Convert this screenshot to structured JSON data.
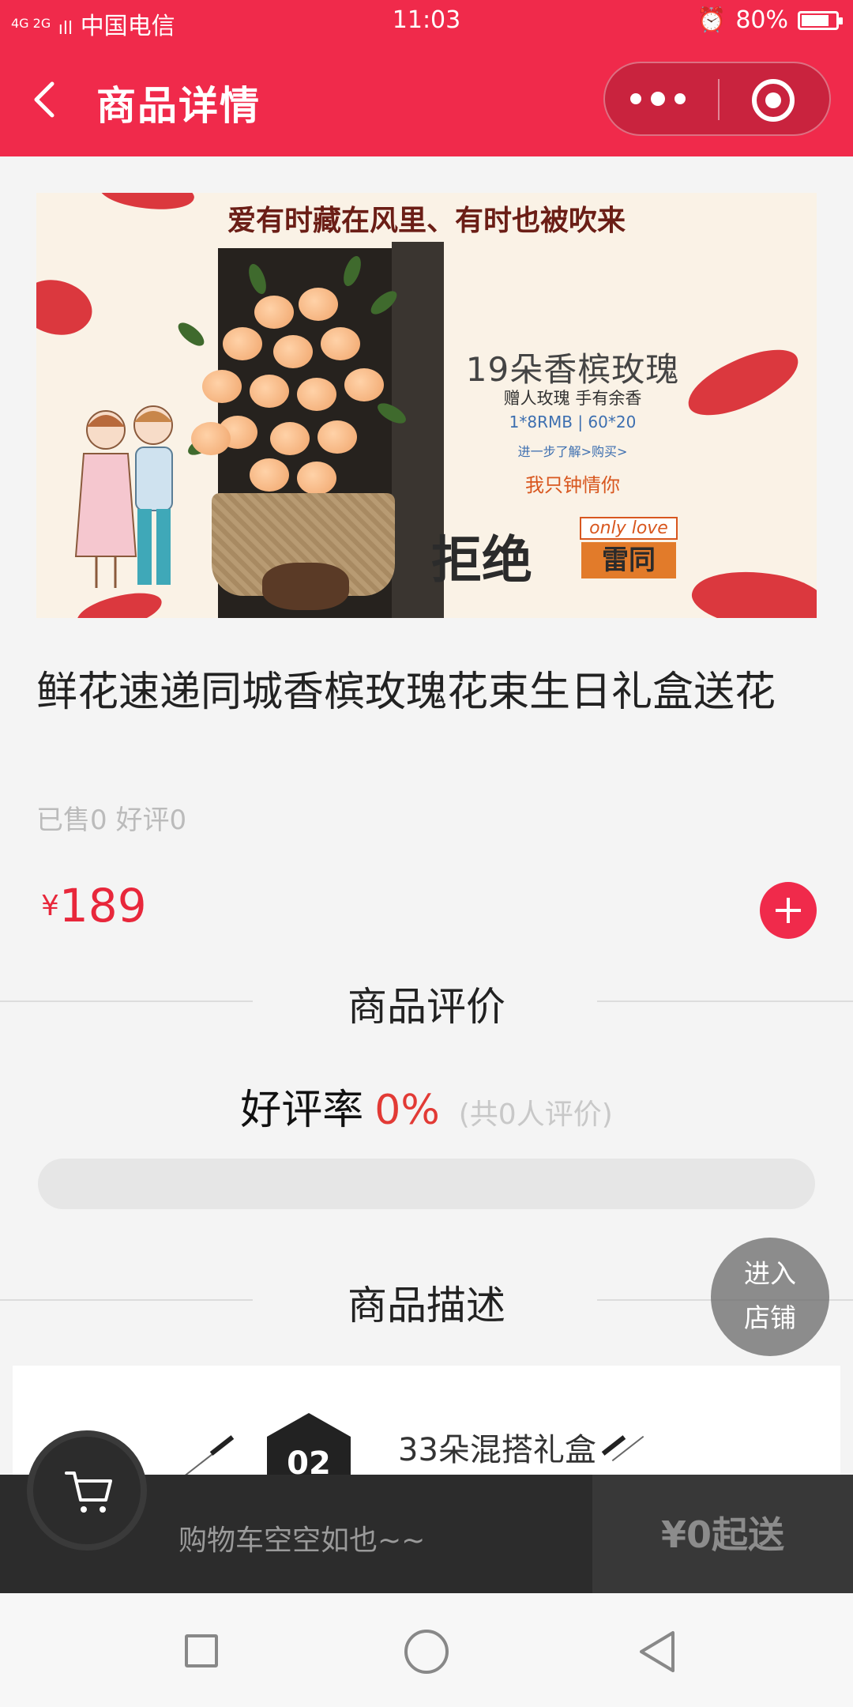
{
  "status_bar": {
    "carrier": "中国电信",
    "signal": "4G 2G",
    "time": "11:03",
    "battery": "80%",
    "battery_level": 0.8
  },
  "header": {
    "title": "商品详情",
    "back_icon": "chevron-left-icon",
    "more_icon": "more-dots-icon",
    "close_icon": "target-close-icon",
    "accent_color": "#f02a4b"
  },
  "banner": {
    "tagline": "爱有时藏在风里、有时也被吹来",
    "headline": "19朵香槟玫瑰",
    "subline": "赠人玫瑰 手有余香",
    "spec": "1*8RMB | 60*20",
    "link": "进一步了解>购买>",
    "slogan": "我只钟情你",
    "big_text": "拒绝",
    "big_text_2": "雷同",
    "only_love": "only love"
  },
  "product": {
    "title": "鲜花速递同城香槟玫瑰花束生日礼盒送花",
    "sales": "已售0 好评0",
    "currency": "¥",
    "price": "189",
    "add_icon": "plus-icon"
  },
  "reviews": {
    "section_title": "商品评价",
    "rate_label": "好评率",
    "rate_value": "0%",
    "rate_fraction": 0,
    "count_text": "(共0人评价)"
  },
  "description": {
    "section_title": "商品描述",
    "step_number": "02",
    "caption": "33朵混搭礼盒"
  },
  "store_button": {
    "line1": "进入",
    "line2": "店铺"
  },
  "cart": {
    "empty_text": "购物车空空如也~~",
    "min_order": "¥0起送",
    "cart_icon": "shopping-cart-icon"
  }
}
